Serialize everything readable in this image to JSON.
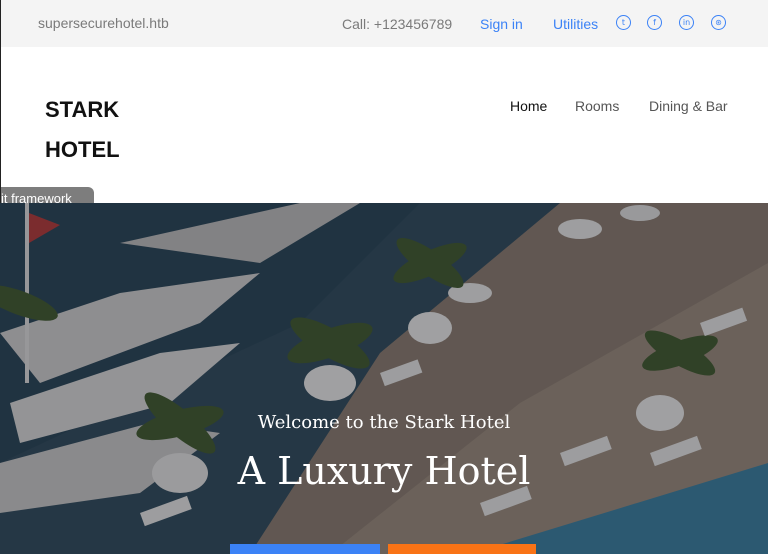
{
  "topbar": {
    "domain": "supersecurehotel.htb",
    "call": "Call: +123456789",
    "sign_in": "Sign in",
    "utilities": "Utilities",
    "social_icons": [
      "twitter-icon",
      "facebook-icon",
      "linkedin-icon",
      "dribbble-icon"
    ],
    "social_glyphs": [
      "t",
      "f",
      "in",
      "⊛"
    ]
  },
  "header": {
    "logo_line1": "STARK",
    "logo_line2": "HOTEL",
    "nav": [
      "Home",
      "Rooms",
      "Dining & Bar"
    ],
    "overlay_tab": "it framework"
  },
  "hero": {
    "welcome": "Welcome to the Stark Hotel",
    "title": "A Luxury Hotel"
  },
  "colors": {
    "link": "#3b82f6",
    "btn_primary": "#3b82f6",
    "btn_secondary": "#f97316"
  }
}
